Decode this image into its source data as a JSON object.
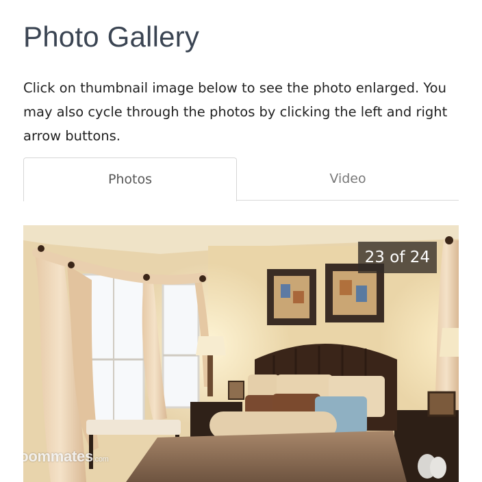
{
  "page": {
    "title": "Photo Gallery",
    "description": "Click on thumbnail image below to see the photo enlarged. You may also cycle through the photos by clicking the left and right arrow buttons."
  },
  "tabs": [
    {
      "label": "Photos",
      "active": true
    },
    {
      "label": "Video",
      "active": false
    }
  ],
  "gallery": {
    "counter": "23 of 24",
    "current_index": 23,
    "total": 24,
    "photo_subject": "bedroom-photo",
    "watermark": {
      "brand": "roommates",
      "suffix": ".com"
    }
  }
}
